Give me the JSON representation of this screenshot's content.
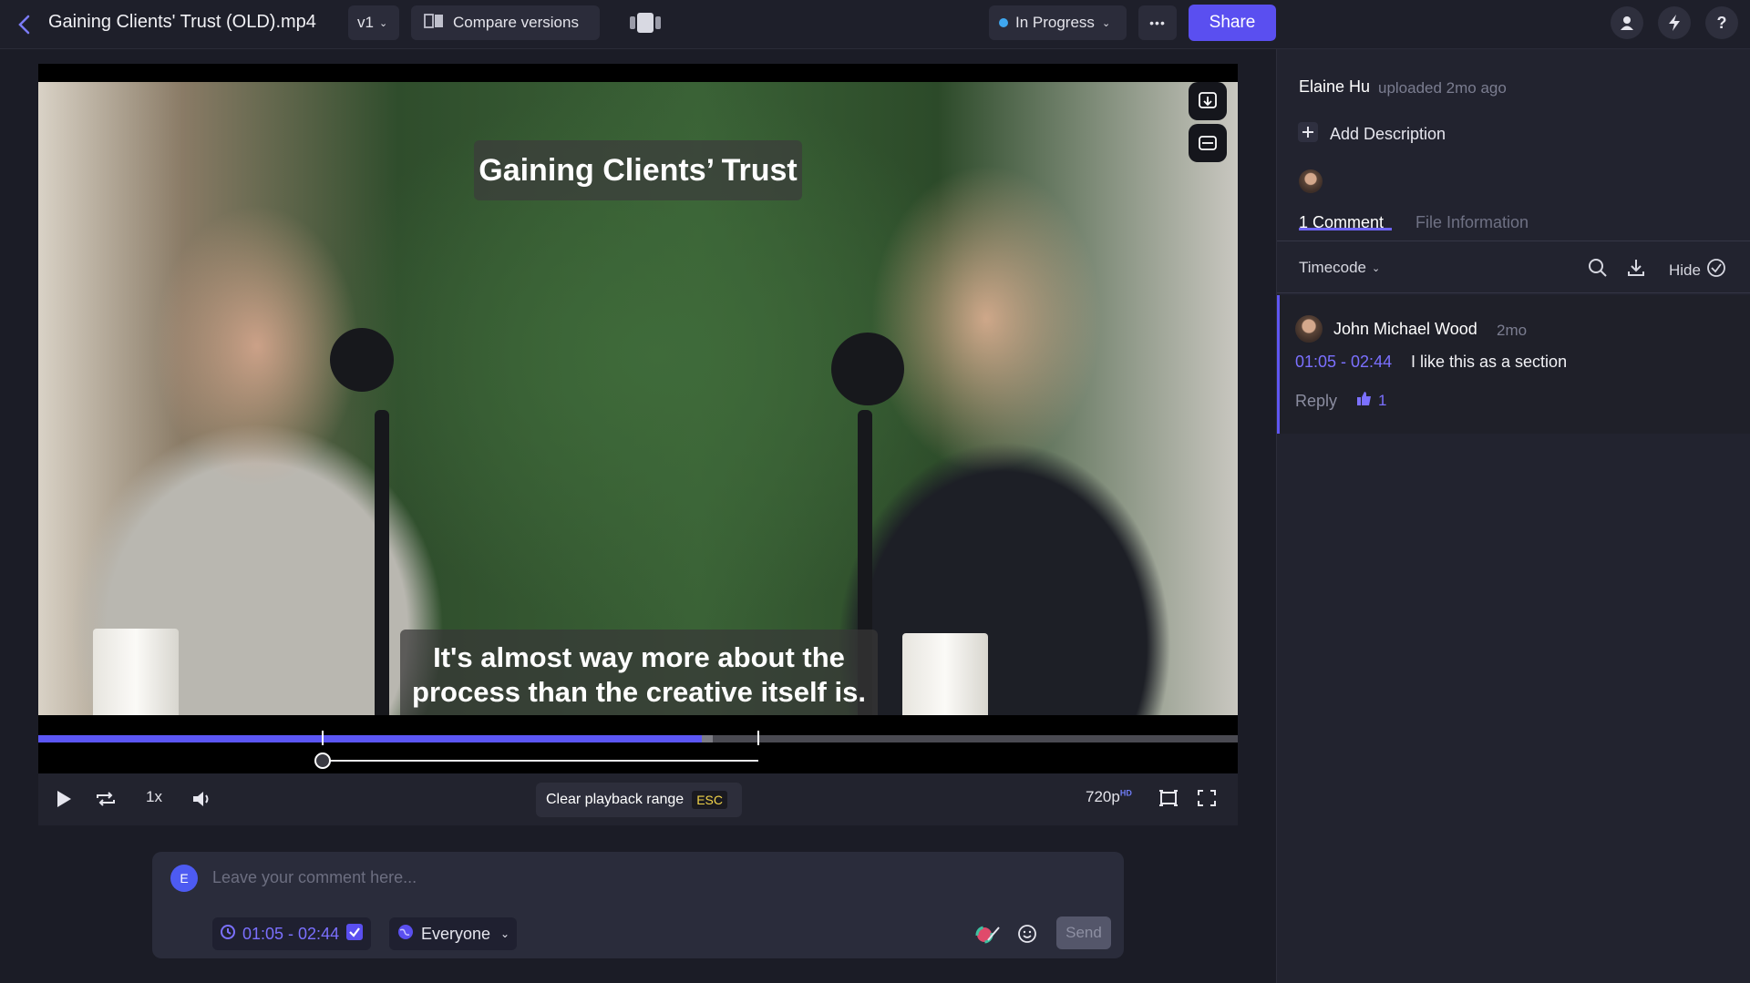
{
  "header": {
    "back_icon": "chevron-left-icon",
    "file_title": "Gaining Clients' Trust (OLD).mp4",
    "version_label": "v1",
    "compare_label": "Compare versions",
    "status_label": "In Progress",
    "status_color": "#3fa7f0",
    "more_label": "•••",
    "share_label": "Share",
    "help_label": "?"
  },
  "video": {
    "overlay_title": "Gaining Clients’ Trust",
    "caption_line1": "It's almost way more about the",
    "caption_line2": "process than the creative itself is.",
    "progress_fraction": 0.553,
    "buffered_fraction": 0.562,
    "range_start_fraction": 0.237,
    "range_end_fraction": 0.6
  },
  "controls": {
    "speed": "1x",
    "clear_range_label": "Clear playback range",
    "esc_label": "ESC",
    "quality": "720p",
    "quality_badge": "HD"
  },
  "composer": {
    "avatar_letter": "E",
    "placeholder": "Leave your comment here...",
    "timecode_range": "01:05 - 02:44",
    "visibility": "Everyone",
    "send_label": "Send"
  },
  "sidebar": {
    "uploader": "Elaine Hu",
    "uploaded_text": "uploaded 2mo ago",
    "add_description": "Add Description",
    "tabs": [
      {
        "label": "1 Comment",
        "active": true
      },
      {
        "label": "File Information",
        "active": false
      }
    ],
    "sort_label": "Timecode",
    "hide_label": "Hide",
    "comments": [
      {
        "author": "John Michael Wood",
        "age": "2mo",
        "timecode": "01:05 - 02:44",
        "text": "I like this as a section",
        "reply_label": "Reply",
        "likes": "1"
      }
    ]
  },
  "colors": {
    "accent": "#5a4ff0",
    "timecode": "#7b70ff"
  }
}
